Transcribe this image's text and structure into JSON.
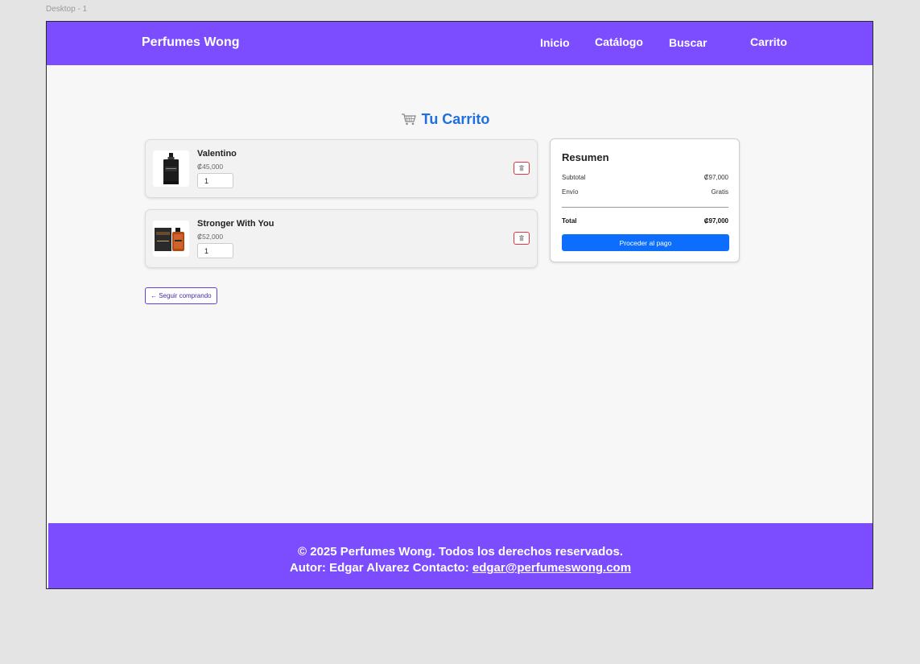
{
  "canvas": {
    "frame_label": "Desktop - 1"
  },
  "navbar": {
    "brand": "Perfumes Wong",
    "links": [
      "Inicio",
      "Catálogo",
      "Buscar",
      "Carrito"
    ]
  },
  "cart": {
    "title": "Tu Carrito",
    "items": [
      {
        "name": "Valentino",
        "price": "₡45,000",
        "quantity": "1"
      },
      {
        "name": "Stronger With You",
        "price": "₡52,000",
        "quantity": "1"
      }
    ],
    "continue_label": "← Seguir comprando"
  },
  "summary": {
    "title": "Resumen",
    "subtotal_label": "Subtotal",
    "subtotal_value": "₡97,000",
    "shipping_label": "Envío",
    "shipping_value": "Gratis",
    "total_label": "Total",
    "total_value": "₡97,000",
    "checkout_label": "Proceder al pago"
  },
  "footer": {
    "line1": "© 2025 Perfumes Wong. Todos los derechos reservados.",
    "author_text": "Autor: Edgar Alvarez Contacto:",
    "email": "edgar@perfumeswong.com"
  },
  "colors": {
    "brand_purple": "#7c4dff",
    "title_blue": "#1e6fe0",
    "checkout_blue": "#0d6efd",
    "danger_red": "#dc3545"
  },
  "icons": [
    "cart-icon",
    "trash-icon",
    "trash-icon"
  ]
}
